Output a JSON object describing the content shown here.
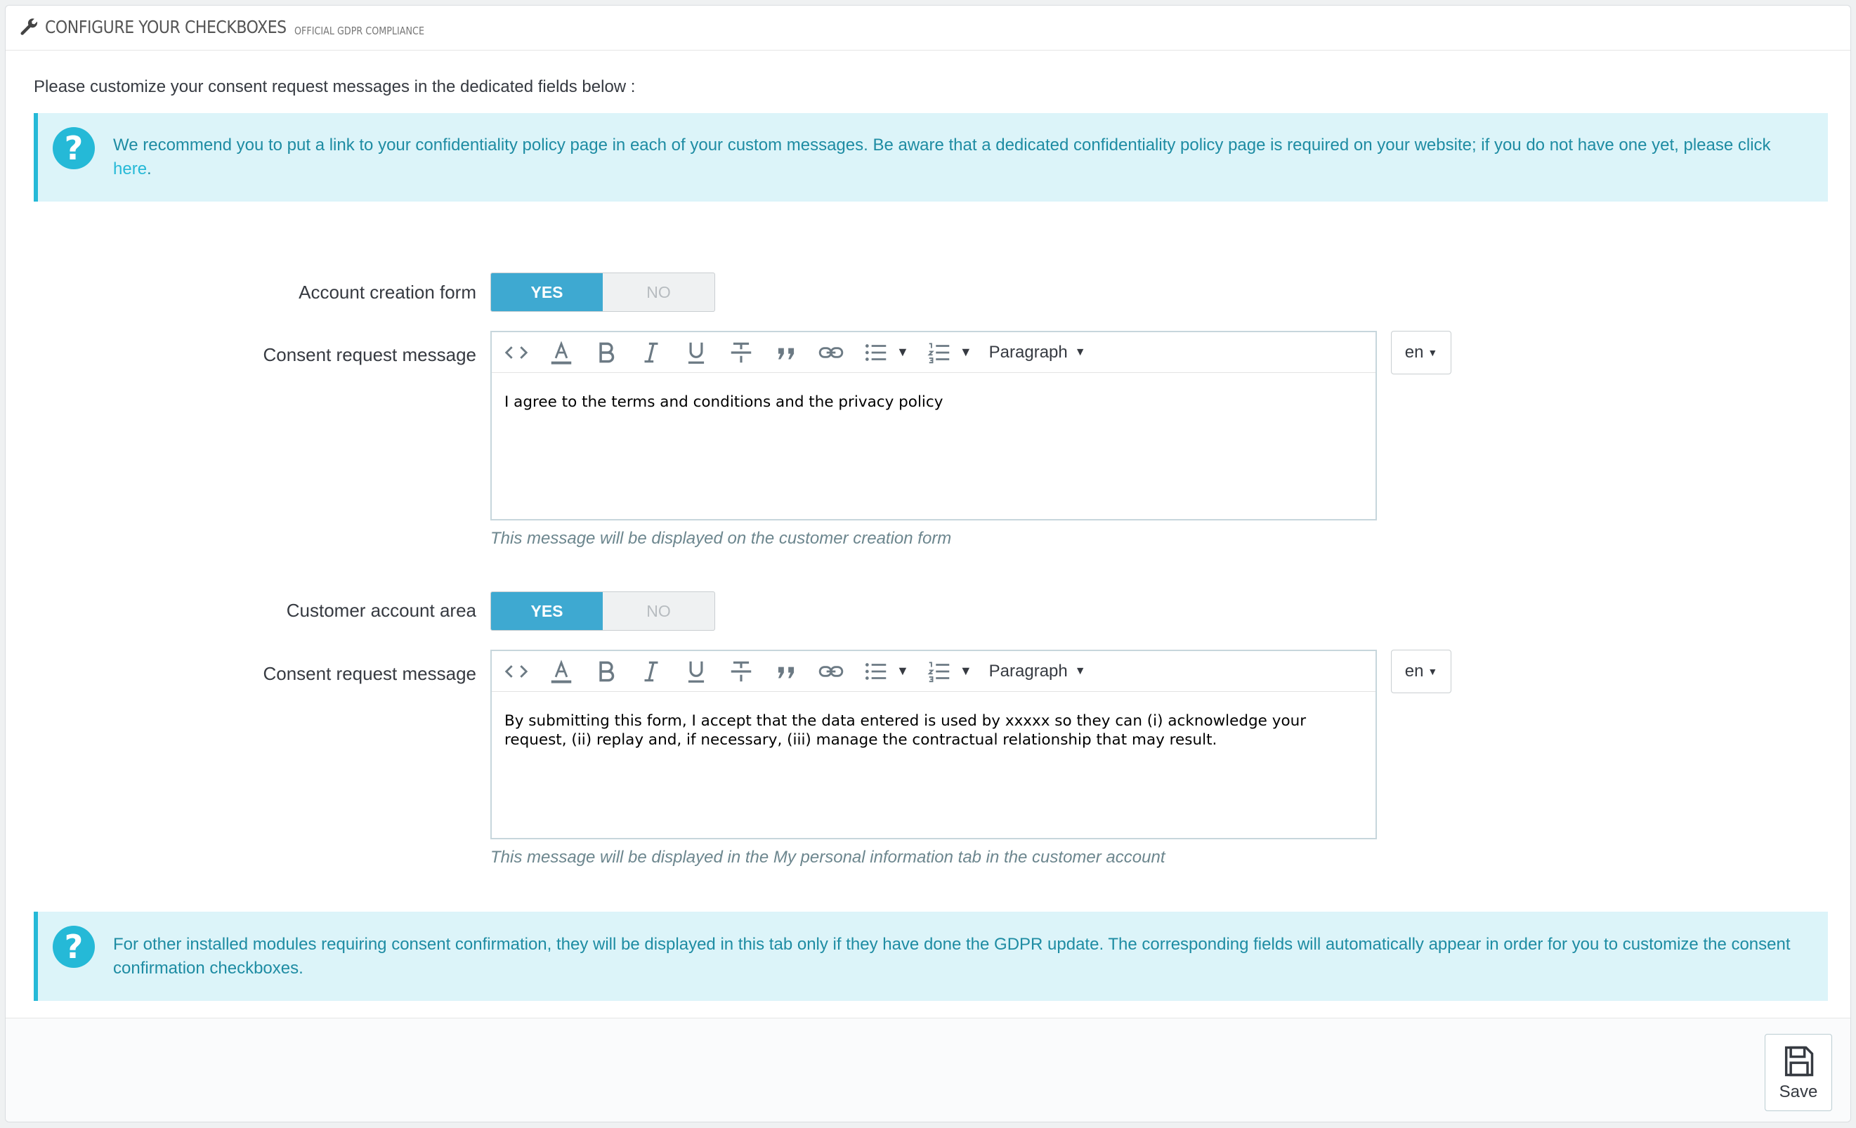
{
  "panel": {
    "title": "CONFIGURE YOUR CHECKBOXES",
    "subtitle": "OFFICIAL GDPR COMPLIANCE",
    "icon": "wrench-icon"
  },
  "intro": "Please customize your consent request messages in the dedicated fields below :",
  "alert_top": {
    "text": "We recommend you to put a link to your confidentiality policy page in each of your custom messages. Be aware that a dedicated confidentiality policy page is required on your website; if you do not have one yet, please click ",
    "link": "here",
    "tail": "."
  },
  "toolbar": {
    "paragraph_label": "Paragraph",
    "icons": [
      "code-icon",
      "text-color-icon",
      "bold-icon",
      "italic-icon",
      "underline-icon",
      "strikethrough-icon",
      "blockquote-icon",
      "link-icon",
      "bullet-list-icon",
      "numbered-list-icon"
    ]
  },
  "section1": {
    "toggle_label": "Account creation form",
    "yes": "YES",
    "no": "NO",
    "selected": "YES",
    "message_label": "Consent request message",
    "message": "I agree to the terms and conditions and the privacy policy",
    "lang": "en",
    "help": "This message will be displayed on the customer creation form"
  },
  "section2": {
    "toggle_label": "Customer account area",
    "yes": "YES",
    "no": "NO",
    "selected": "YES",
    "message_label": "Consent request message",
    "message": "By submitting this form, I accept that the data entered is used by xxxxx so they can (i) acknowledge your request, (ii) replay and, if necessary, (iii) manage the contractual relationship that may result.",
    "lang": "en",
    "help": "This message will be displayed in the My personal information tab in the customer account"
  },
  "alert_bottom": {
    "text": "For other installed modules requiring consent confirmation, they will be displayed in this tab only if they have done the GDPR update. The corresponding fields will automatically appear in order for you to customize the consent confirmation checkboxes."
  },
  "footer": {
    "save_label": "Save"
  },
  "colors": {
    "accent": "#25b9d7",
    "switch_on": "#3ea9d1",
    "alert_bg": "#dcf4f9",
    "alert_text": "#1e8ca3"
  }
}
